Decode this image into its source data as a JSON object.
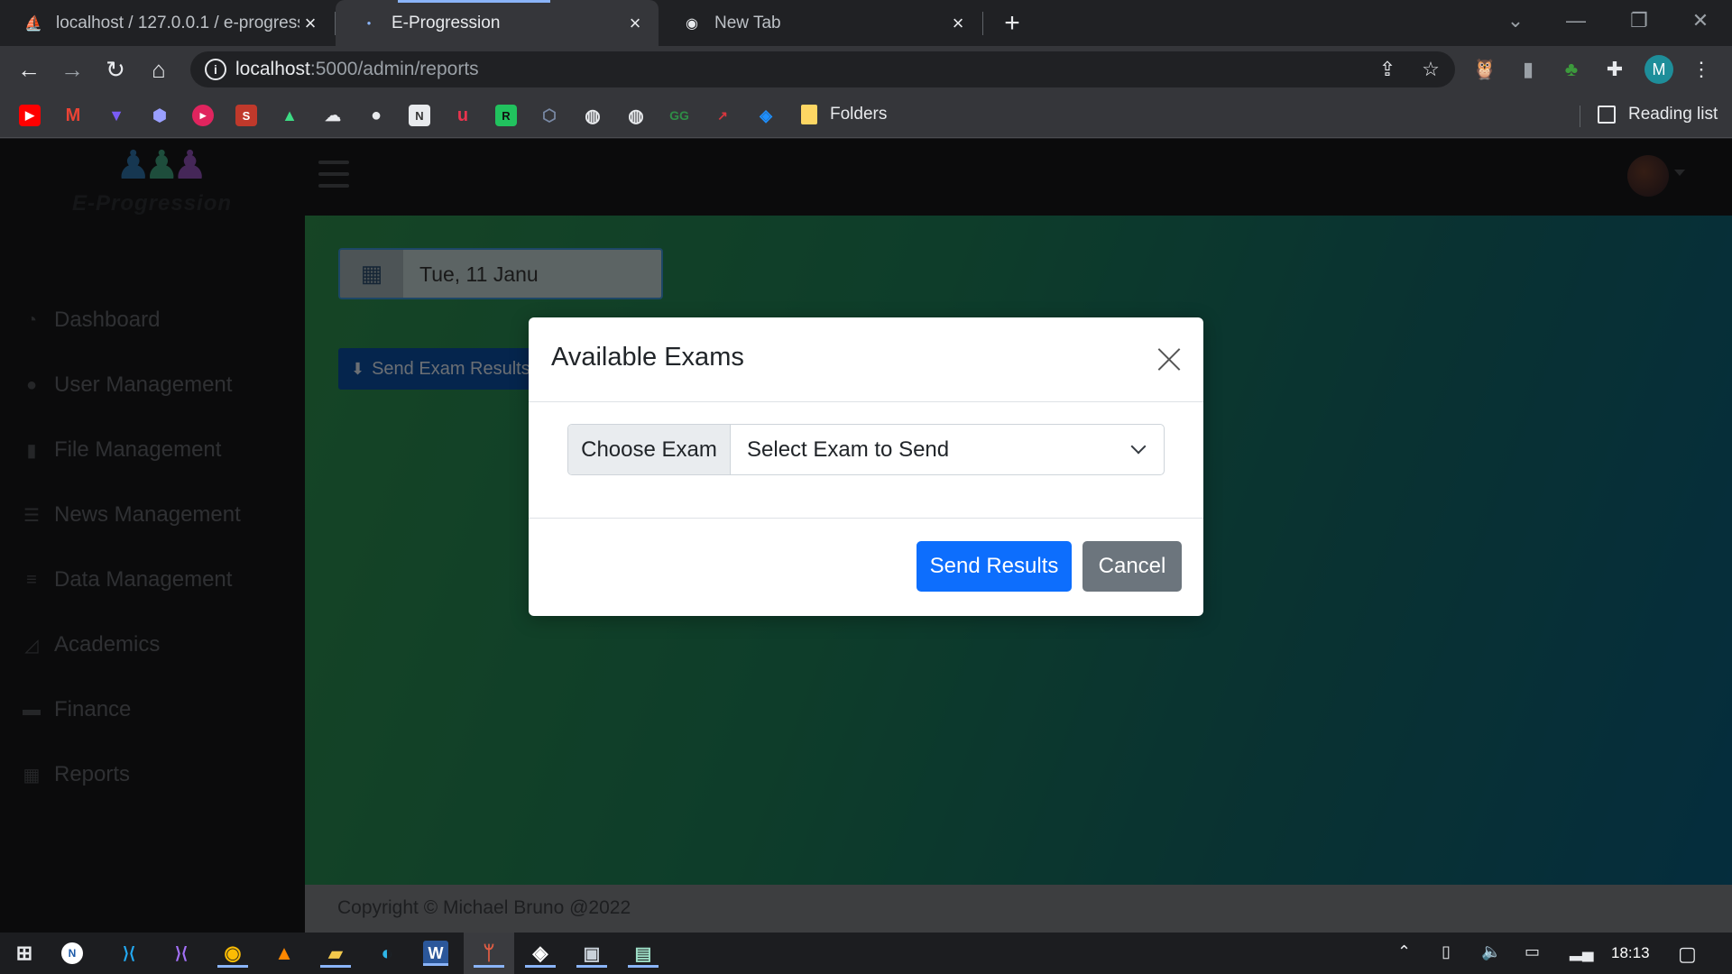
{
  "browser": {
    "tabs": [
      {
        "title": "localhost / 127.0.0.1 / e-progress",
        "icon": "phpmyadmin-icon",
        "active": false
      },
      {
        "title": "E-Progression",
        "icon": "site-favicon",
        "active": true
      },
      {
        "title": "New Tab",
        "icon": "chrome-icon",
        "active": false
      }
    ],
    "url_host": "localhost",
    "url_path": ":5000/admin/reports",
    "profile_initial": "M",
    "bookmarks_folder": "Folders",
    "reading_list": "Reading list"
  },
  "app": {
    "brand_name": "E-Progression",
    "nav": [
      {
        "label": "Dashboard",
        "icon": "tachometer-icon"
      },
      {
        "label": "User Management",
        "icon": "user-icon"
      },
      {
        "label": "File Management",
        "icon": "file-icon"
      },
      {
        "label": "News Management",
        "icon": "newspaper-icon"
      },
      {
        "label": "Data Management",
        "icon": "database-icon"
      },
      {
        "label": "Academics",
        "icon": "chart-area-icon"
      },
      {
        "label": "Finance",
        "icon": "money-icon"
      },
      {
        "label": "Reports",
        "icon": "table-icon"
      }
    ],
    "date_text": "Tue, 11 Janu",
    "send_exam_button": "Send Exam Results",
    "footer": "Copyright © Michael Bruno @2022"
  },
  "modal": {
    "title": "Available Exams",
    "input_label": "Choose Exam",
    "select_value": "Select Exam to Send",
    "send_button": "Send Results",
    "cancel_button": "Cancel"
  },
  "taskbar": {
    "clock": "18:13"
  },
  "colors": {
    "primary": "#0d6efd",
    "secondary": "#6c757d",
    "gradient_start": "#2c8a4a",
    "gradient_end": "#0a5a7a"
  }
}
